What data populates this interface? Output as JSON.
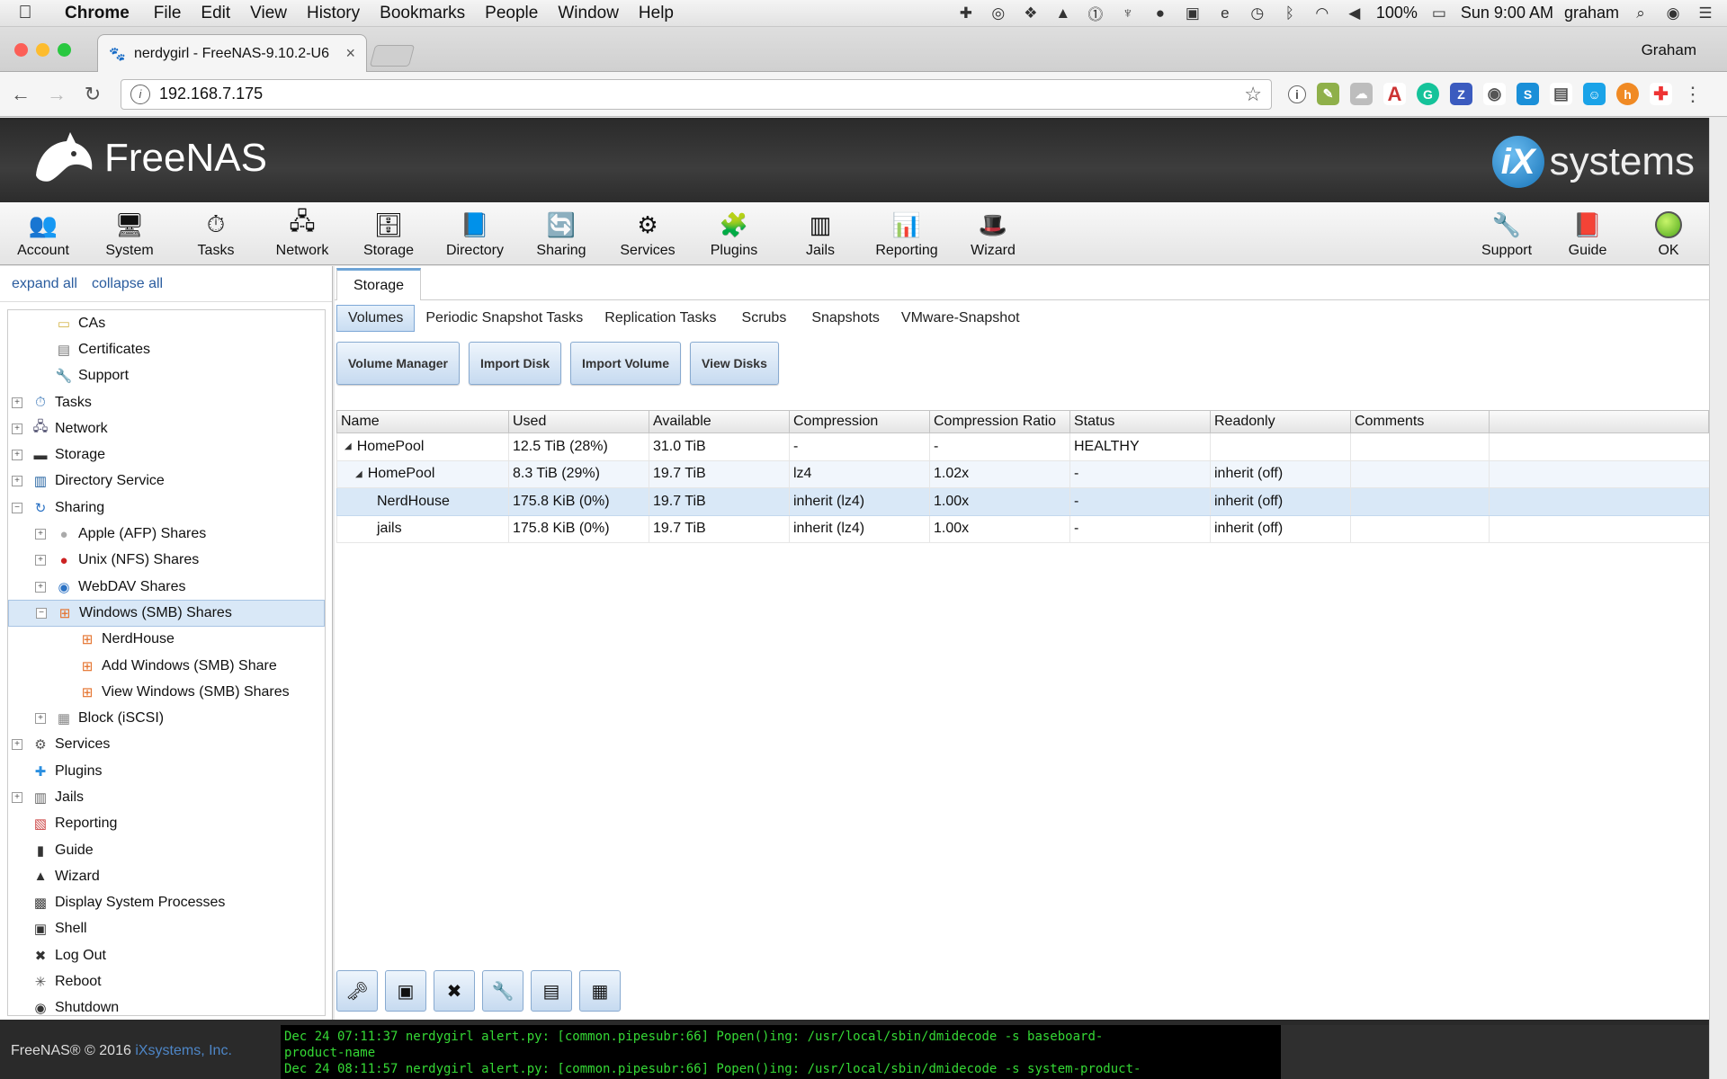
{
  "menubar": {
    "app": "Chrome",
    "items": [
      "File",
      "Edit",
      "View",
      "History",
      "Bookmarks",
      "People",
      "Window",
      "Help"
    ],
    "battery": "100%",
    "clock": "Sun 9:00 AM",
    "user": "graham"
  },
  "browser": {
    "tab_title": "nerdygirl - FreeNAS-9.10.2-U6",
    "profile": "Graham",
    "url": "192.168.7.175"
  },
  "freenas": {
    "logo_text": "FreeNAS",
    "vendor_logo": "systems",
    "vendor_badge": "iX",
    "nav": [
      "Account",
      "System",
      "Tasks",
      "Network",
      "Storage",
      "Directory",
      "Sharing",
      "Services",
      "Plugins",
      "Jails",
      "Reporting",
      "Wizard"
    ],
    "nav_right": [
      "Support",
      "Guide",
      "OK"
    ]
  },
  "sidebar": {
    "expand_all": "expand all",
    "collapse_all": "collapse all",
    "tree": [
      {
        "label": "CAs",
        "level": 2,
        "toggle": "",
        "icon": "ca-icon"
      },
      {
        "label": "Certificates",
        "level": 2,
        "toggle": "",
        "icon": "certificate-icon"
      },
      {
        "label": "Support",
        "level": 2,
        "toggle": "",
        "icon": "support-icon"
      },
      {
        "label": "Tasks",
        "level": 1,
        "toggle": "+",
        "icon": "tasks-icon"
      },
      {
        "label": "Network",
        "level": 1,
        "toggle": "+",
        "icon": "network-icon"
      },
      {
        "label": "Storage",
        "level": 1,
        "toggle": "+",
        "icon": "storage-icon"
      },
      {
        "label": "Directory Service",
        "level": 1,
        "toggle": "+",
        "icon": "directory-icon"
      },
      {
        "label": "Sharing",
        "level": 1,
        "toggle": "−",
        "icon": "sharing-icon"
      },
      {
        "label": "Apple (AFP) Shares",
        "level": 2,
        "toggle": "+",
        "icon": "apple-icon"
      },
      {
        "label": "Unix (NFS) Shares",
        "level": 2,
        "toggle": "+",
        "icon": "unix-icon"
      },
      {
        "label": "WebDAV Shares",
        "level": 2,
        "toggle": "+",
        "icon": "webdav-icon"
      },
      {
        "label": "Windows (SMB) Shares",
        "level": 2,
        "toggle": "−",
        "icon": "windows-icon",
        "selected": true
      },
      {
        "label": "NerdHouse",
        "level": 3,
        "toggle": "",
        "icon": "windows-icon"
      },
      {
        "label": "Add Windows (SMB) Share",
        "level": 3,
        "toggle": "",
        "icon": "windows-add-icon"
      },
      {
        "label": "View Windows (SMB) Shares",
        "level": 3,
        "toggle": "",
        "icon": "windows-view-icon"
      },
      {
        "label": "Block (iSCSI)",
        "level": 2,
        "toggle": "+",
        "icon": "iscsi-icon"
      },
      {
        "label": "Services",
        "level": 1,
        "toggle": "+",
        "icon": "services-icon"
      },
      {
        "label": "Plugins",
        "level": 1,
        "toggle": "",
        "icon": "plugins-icon"
      },
      {
        "label": "Jails",
        "level": 1,
        "toggle": "+",
        "icon": "jails-icon"
      },
      {
        "label": "Reporting",
        "level": 1,
        "toggle": "",
        "icon": "reporting-icon"
      },
      {
        "label": "Guide",
        "level": 1,
        "toggle": "",
        "icon": "guide-icon"
      },
      {
        "label": "Wizard",
        "level": 1,
        "toggle": "",
        "icon": "wizard-icon"
      },
      {
        "label": "Display System Processes",
        "level": 1,
        "toggle": "",
        "icon": "processes-icon"
      },
      {
        "label": "Shell",
        "level": 1,
        "toggle": "",
        "icon": "shell-icon"
      },
      {
        "label": "Log Out",
        "level": 1,
        "toggle": "",
        "icon": "logout-icon"
      },
      {
        "label": "Reboot",
        "level": 1,
        "toggle": "",
        "icon": "reboot-icon"
      },
      {
        "label": "Shutdown",
        "level": 1,
        "toggle": "",
        "icon": "shutdown-icon"
      }
    ]
  },
  "content": {
    "main_tab": "Storage",
    "subtabs": [
      "Volumes",
      "Periodic Snapshot Tasks",
      "Replication Tasks",
      "Scrubs",
      "Snapshots",
      "VMware-Snapshot"
    ],
    "actions": [
      "Volume Manager",
      "Import Disk",
      "Import Volume",
      "View Disks"
    ],
    "columns": [
      "Name",
      "Used",
      "Available",
      "Compression",
      "Compression Ratio",
      "Status",
      "Readonly",
      "Comments"
    ],
    "rows": [
      {
        "name": "HomePool",
        "used": "12.5 TiB (28%)",
        "available": "31.0 TiB",
        "compression": "-",
        "ratio": "-",
        "status": "HEALTHY",
        "readonly": "",
        "comments": ""
      },
      {
        "name": "HomePool",
        "used": "8.3 TiB (29%)",
        "available": "19.7 TiB",
        "compression": "lz4",
        "ratio": "1.02x",
        "status": "-",
        "readonly": "inherit (off)",
        "comments": ""
      },
      {
        "name": "NerdHouse",
        "used": "175.8 KiB (0%)",
        "available": "19.7 TiB",
        "compression": "inherit (lz4)",
        "ratio": "1.00x",
        "status": "-",
        "readonly": "inherit (off)",
        "comments": ""
      },
      {
        "name": "jails",
        "used": "175.8 KiB (0%)",
        "available": "19.7 TiB",
        "compression": "inherit (lz4)",
        "ratio": "1.00x",
        "status": "-",
        "readonly": "inherit (off)",
        "comments": ""
      }
    ]
  },
  "footer": {
    "copyright": "FreeNAS® © 2016 ",
    "company": "iXsystems, Inc.",
    "console": [
      "Dec 24 07:11:37 nerdygirl alert.py: [common.pipesubr:66] Popen()ing: /usr/local/sbin/dmidecode -s baseboard-",
      "product-name",
      "Dec 24 08:11:57 nerdygirl alert.py: [common.pipesubr:66] Popen()ing: /usr/local/sbin/dmidecode -s system-product-"
    ]
  }
}
